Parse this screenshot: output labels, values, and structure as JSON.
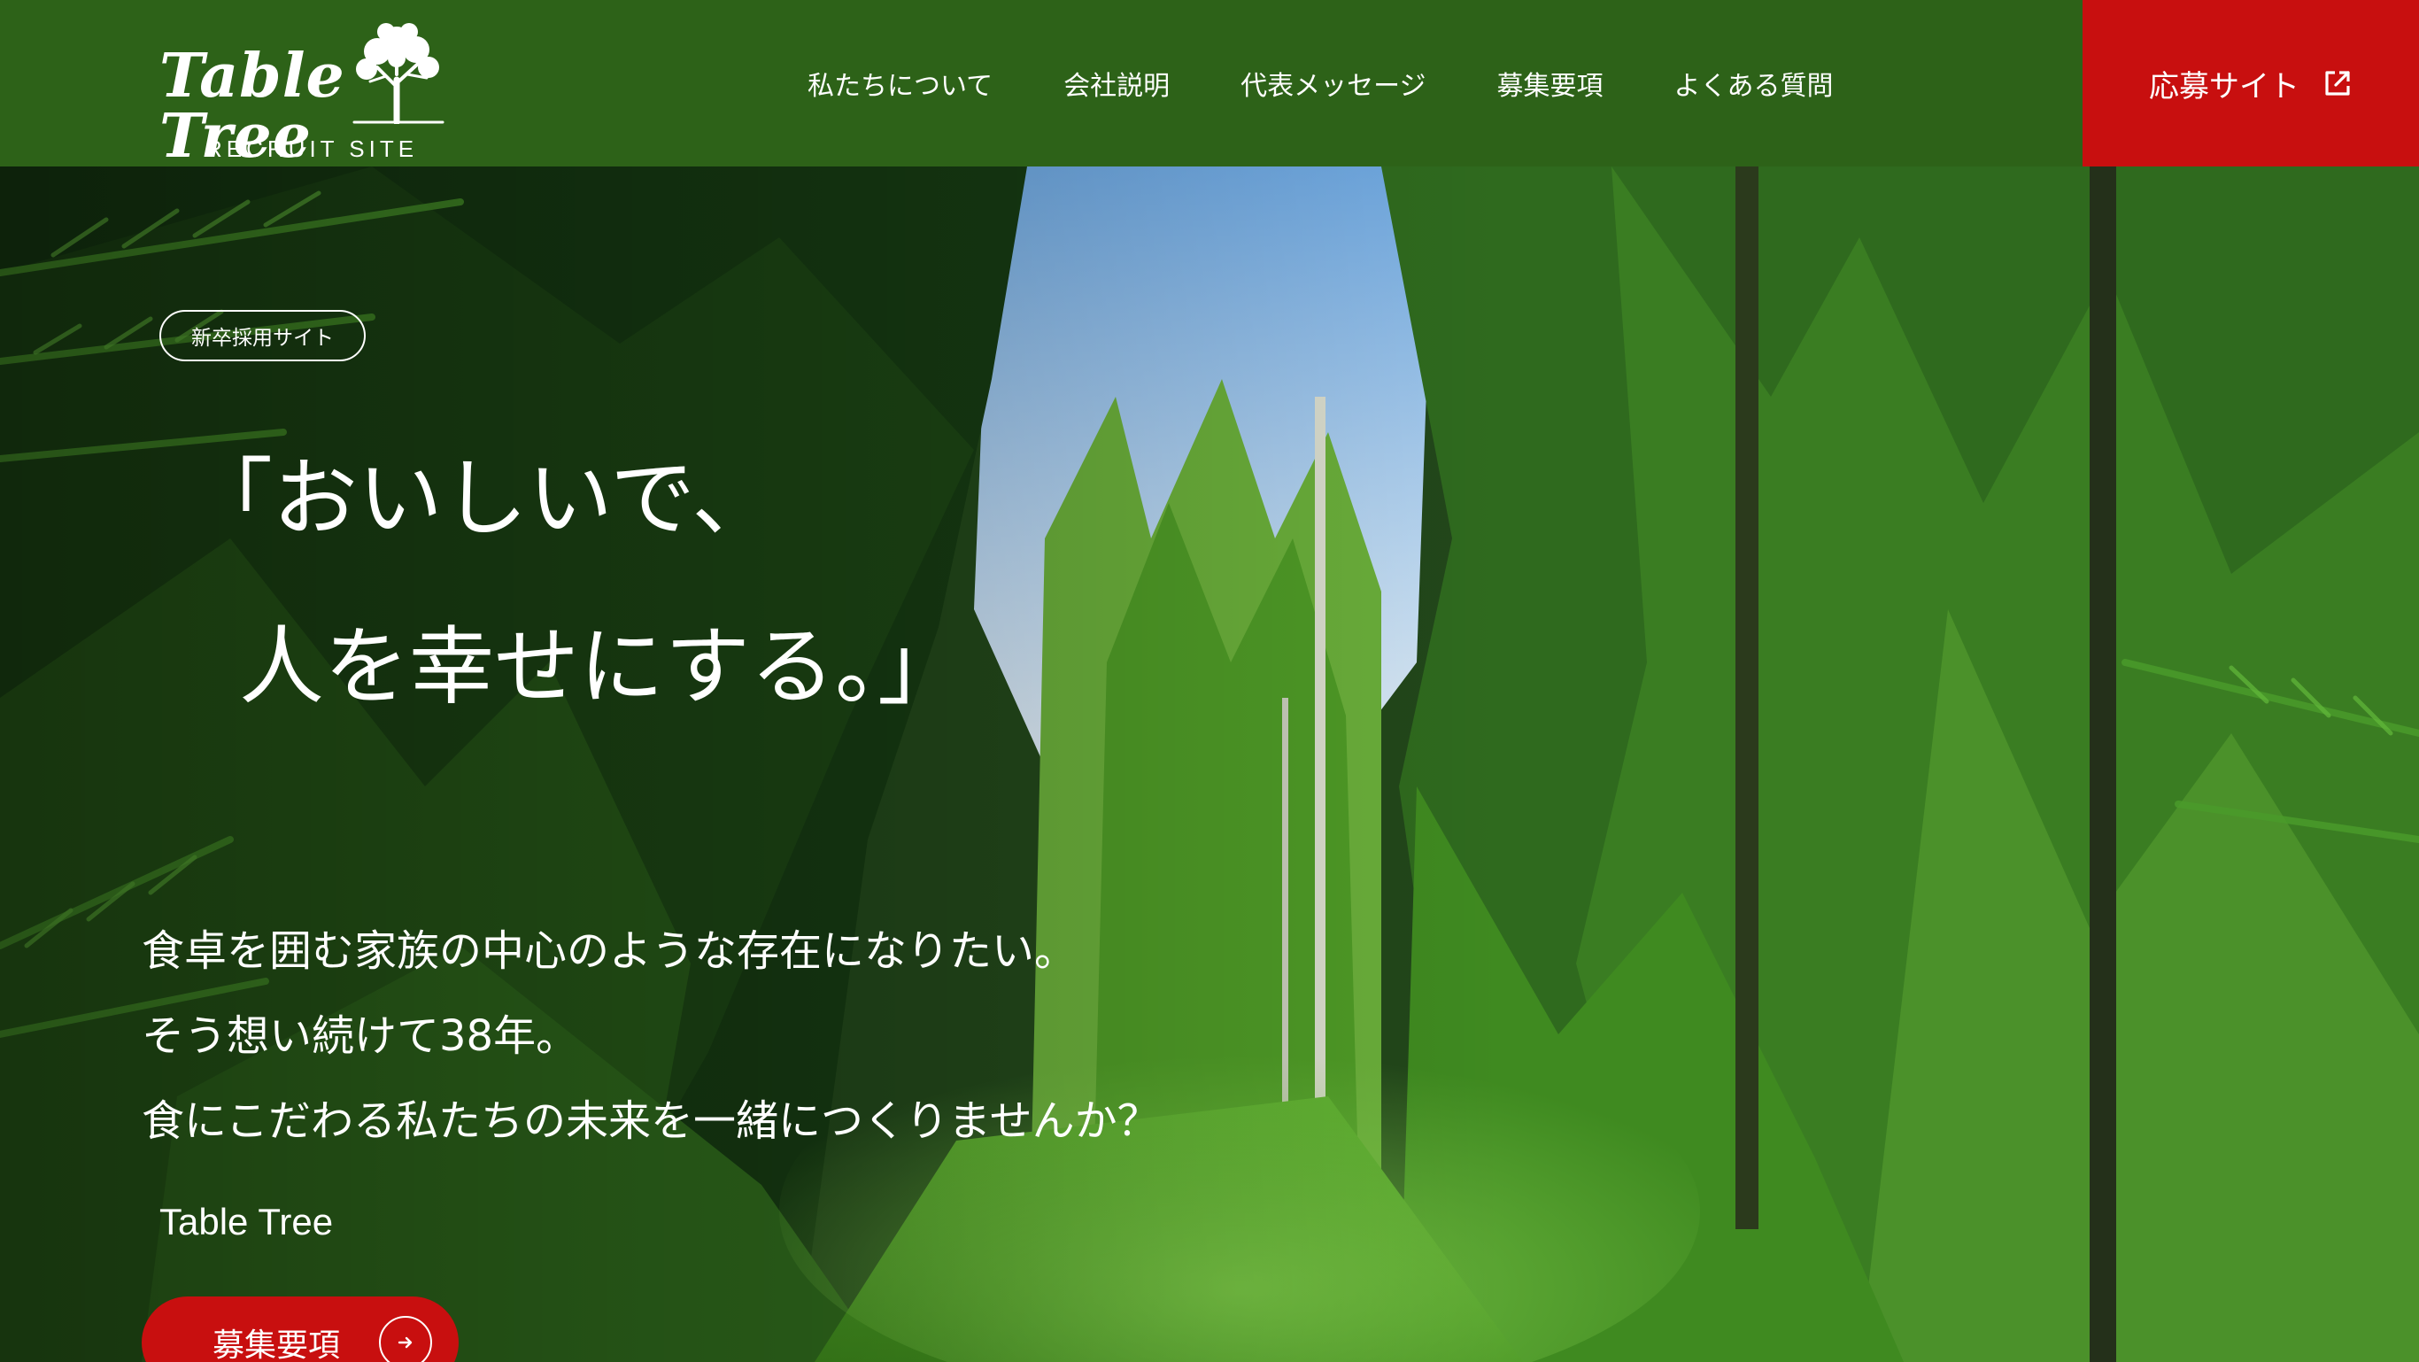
{
  "header": {
    "logo_text": "Table Tree",
    "logo_sub": "RECRUIT SITE",
    "nav": [
      {
        "label": "私たちについて"
      },
      {
        "label": "会社説明"
      },
      {
        "label": "代表メッセージ"
      },
      {
        "label": "募集要項"
      },
      {
        "label": "よくある質問"
      }
    ],
    "apply_button": {
      "label": "応募サイト",
      "icon": "external-link-icon"
    }
  },
  "hero": {
    "badge": "新卒採用サイト",
    "headline_line1": "「おいしいで、",
    "headline_line2": "人を幸せにする。」",
    "lead": [
      "食卓を囲む家族の中心のような存在になりたい。",
      "そう想い続けて38年。",
      "食にこだわる私たちの未来を一緒につくりませんか？"
    ],
    "company": "Table Tree",
    "cta": {
      "label": "募集要項",
      "icon": "arrow-right-icon"
    },
    "background": "forest-photo"
  },
  "colors": {
    "header_green": "#2d6218",
    "accent_red": "#c80f0f",
    "text": "#ffffff"
  }
}
